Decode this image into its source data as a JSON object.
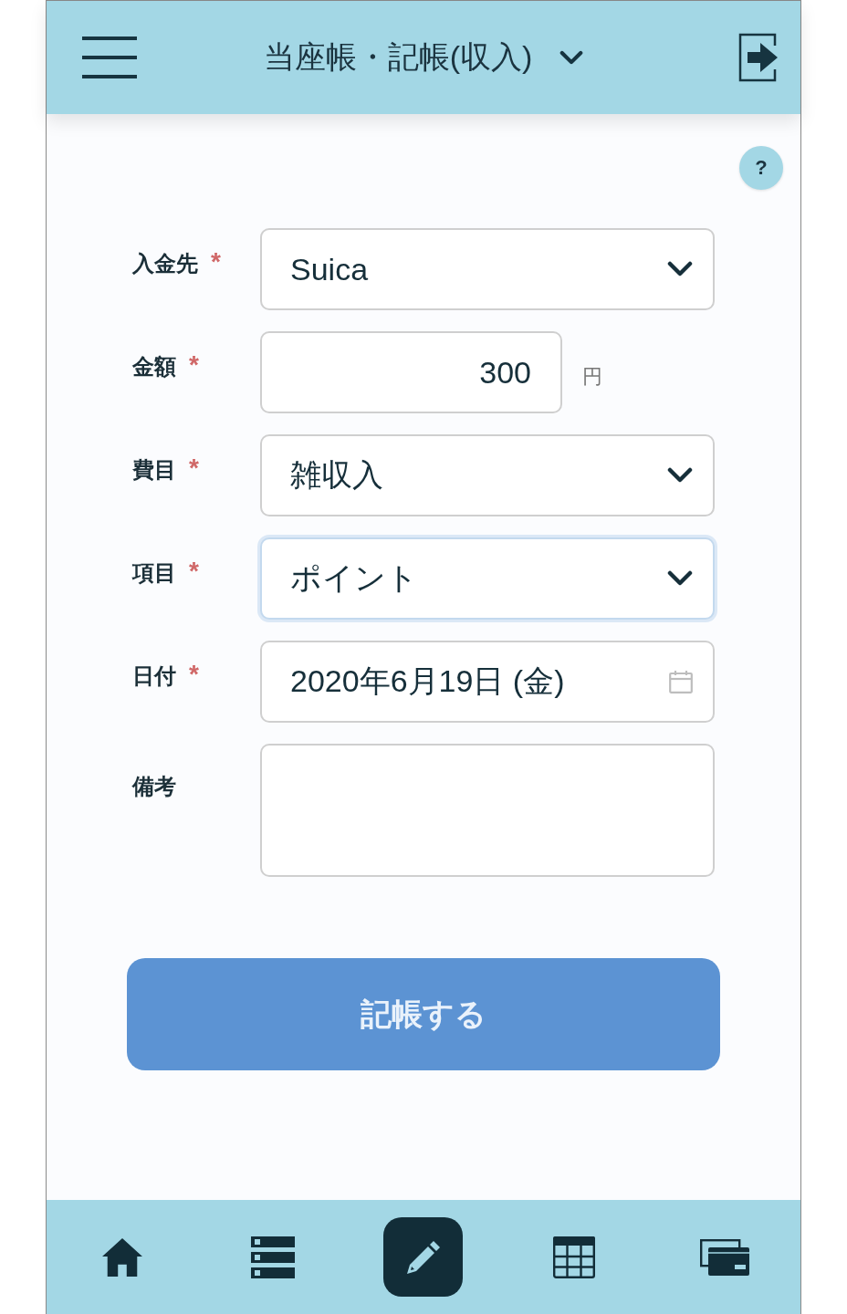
{
  "header": {
    "title": "当座帳・記帳(収入)"
  },
  "help_button": {
    "label": "?"
  },
  "form": {
    "fields": [
      {
        "kind": "select",
        "label": "入金先",
        "required_mark": "*",
        "value": "Suica",
        "focused": false
      },
      {
        "kind": "amount",
        "label": "金額",
        "required_mark": "*",
        "value": "300",
        "unit": "円",
        "focused": false
      },
      {
        "kind": "select",
        "label": "費目",
        "required_mark": "*",
        "value": "雑収入",
        "focused": false
      },
      {
        "kind": "select",
        "label": "項目",
        "required_mark": "*",
        "value": "ポイント",
        "focused": true
      },
      {
        "kind": "date",
        "label": "日付",
        "required_mark": "*",
        "value": "2020年6月19日 (金)",
        "focused": false
      },
      {
        "kind": "textarea",
        "label": "備考",
        "focused": false
      }
    ]
  },
  "submit_button": {
    "label": "記帳する"
  },
  "bottom_nav": [
    {
      "kind": "home",
      "selected": false
    },
    {
      "kind": "list",
      "selected": false
    },
    {
      "kind": "edit",
      "selected": true
    },
    {
      "kind": "table",
      "selected": false
    },
    {
      "kind": "cards",
      "selected": false
    }
  ]
}
